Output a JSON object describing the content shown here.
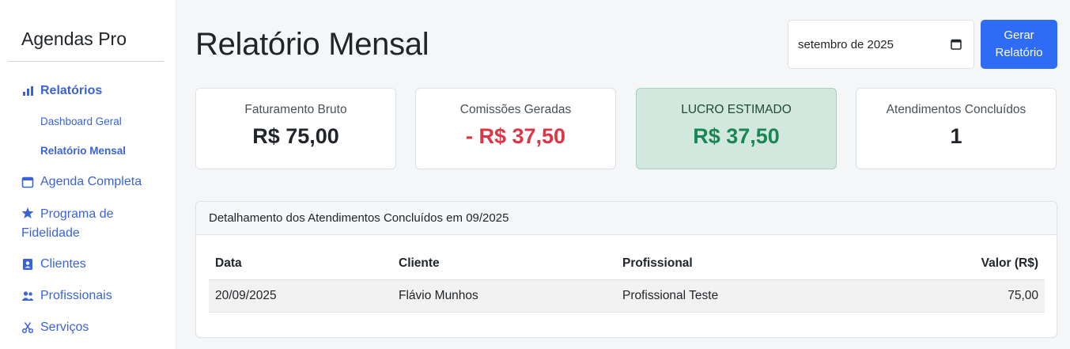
{
  "sidebar": {
    "brand": "Agendas Pro",
    "items": [
      {
        "label": "Relatórios",
        "icon": "bar-chart-icon"
      },
      {
        "label": "Dashboard Geral"
      },
      {
        "label": "Relatório Mensal"
      },
      {
        "label": "Agenda Completa",
        "icon": "calendar-icon"
      },
      {
        "label": "Programa de Fidelidade",
        "icon": "star-icon"
      },
      {
        "label": "Clientes",
        "icon": "contact-card-icon"
      },
      {
        "label": "Profissionais",
        "icon": "users-icon"
      },
      {
        "label": "Serviços",
        "icon": "scissors-icon"
      }
    ]
  },
  "header": {
    "title": "Relatório Mensal",
    "month_value": "setembro de 2025",
    "generate_label": "Gerar Relatório"
  },
  "cards": [
    {
      "label": "Faturamento Bruto",
      "value": "R$ 75,00",
      "color": "#212529"
    },
    {
      "label": "Comissões Geradas",
      "value": "- R$ 37,50",
      "color": "#dc3545"
    },
    {
      "label": "LUCRO ESTIMADO",
      "value": "R$ 37,50",
      "color": "#198754"
    },
    {
      "label": "Atendimentos Concluídos",
      "value": "1",
      "color": "#212529"
    }
  ],
  "details": {
    "title": "Detalhamento dos Atendimentos Concluídos em 09/2025",
    "columns": [
      "Data",
      "Cliente",
      "Profissional",
      "Valor (R$)"
    ],
    "rows": [
      [
        "20/09/2025",
        "Flávio Munhos",
        "Profissional Teste",
        "75,00"
      ]
    ]
  },
  "colors": {
    "accent": "#3b63d9",
    "button": "#2f6cf6",
    "profit_bg": "#d2e8de"
  }
}
